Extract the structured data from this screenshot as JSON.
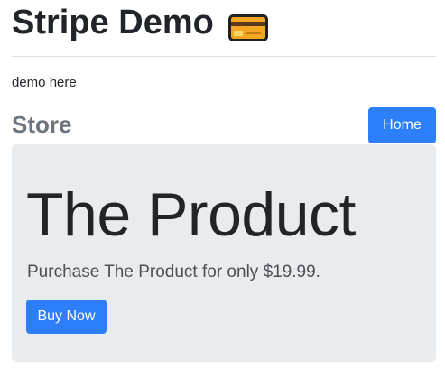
{
  "header": {
    "title": "Stripe Demo",
    "icon": "credit-card-icon"
  },
  "intro": "demo here",
  "store": {
    "heading": "Store",
    "home_button": "Home"
  },
  "product": {
    "title": "The Product",
    "description": "Purchase The Product for only $19.99.",
    "buy_button": "Buy Now"
  },
  "colors": {
    "primary": "#2d7ff9",
    "jumbotron_bg": "#e9ecef",
    "muted_text": "#6c757d"
  }
}
